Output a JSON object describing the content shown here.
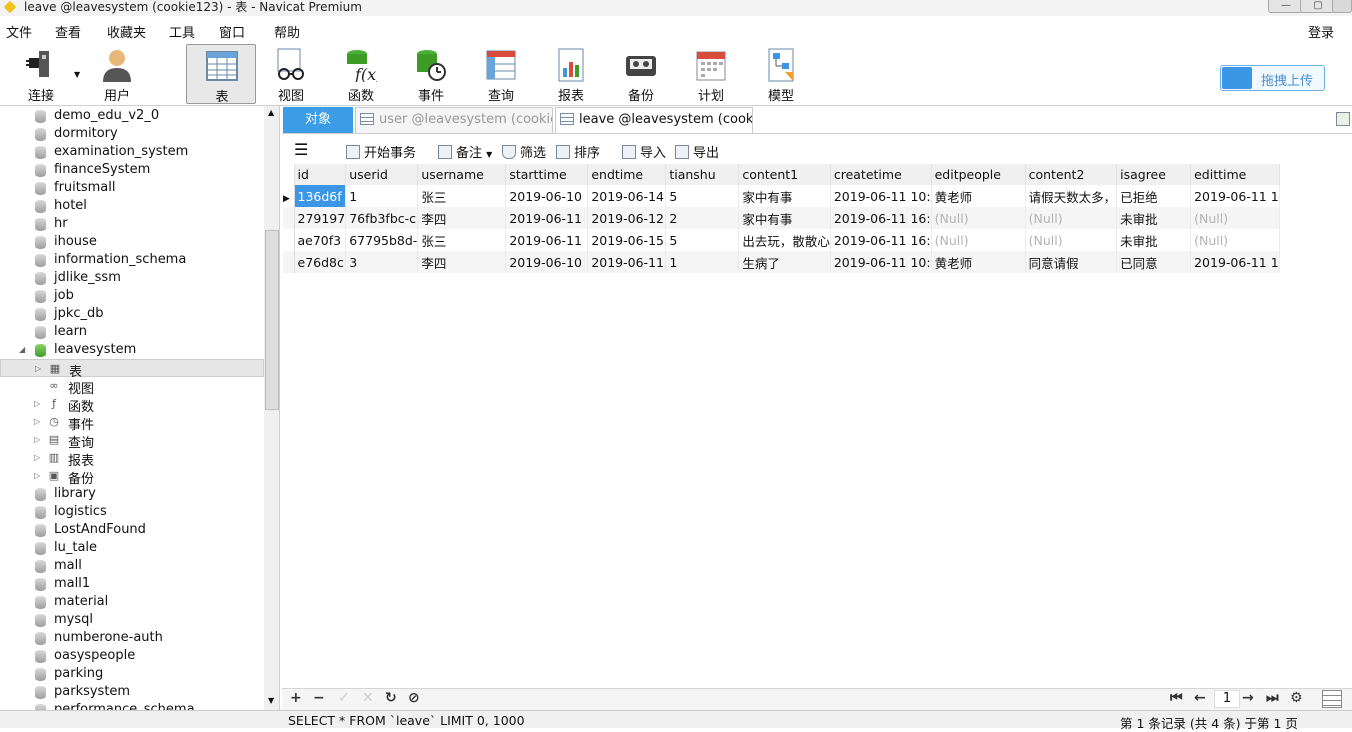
{
  "window": {
    "title": "leave @leavesystem (cookie123) - 表 - Navicat Premium",
    "min": "—",
    "max": "▢",
    "close": "✕"
  },
  "menu": [
    "文件",
    "查看",
    "收藏夹",
    "工具",
    "窗口",
    "帮助"
  ],
  "login": "登录",
  "toolbar": [
    {
      "label": "连接",
      "icon": "plug-icon"
    },
    {
      "label": "用户",
      "icon": "user-icon"
    },
    {
      "label": "表",
      "icon": "table-icon"
    },
    {
      "label": "视图",
      "icon": "glasses-icon"
    },
    {
      "label": "函数",
      "icon": "function-icon"
    },
    {
      "label": "事件",
      "icon": "event-icon"
    },
    {
      "label": "查询",
      "icon": "query-icon"
    },
    {
      "label": "报表",
      "icon": "report-icon"
    },
    {
      "label": "备份",
      "icon": "backup-icon"
    },
    {
      "label": "计划",
      "icon": "calendar-icon"
    },
    {
      "label": "模型",
      "icon": "model-icon"
    }
  ],
  "cloud_button": "拖拽上传",
  "sidebar": {
    "items": [
      "demo_edu_v2_0",
      "dormitory",
      "examination_system",
      "financeSystem",
      "fruitsmall",
      "hotel",
      "hr",
      "ihouse",
      "information_schema",
      "jdlike_ssm",
      "job",
      "jpkc_db",
      "learn",
      "leavesystem"
    ],
    "children": [
      {
        "label": "表",
        "icon": "table-icon"
      },
      {
        "label": "视图",
        "icon": "glasses-icon"
      },
      {
        "label": "函数",
        "icon": "function-icon"
      },
      {
        "label": "事件",
        "icon": "event-icon"
      },
      {
        "label": "查询",
        "icon": "query-icon"
      },
      {
        "label": "报表",
        "icon": "report-icon"
      },
      {
        "label": "备份",
        "icon": "backup-icon"
      }
    ],
    "items_after": [
      "library",
      "logistics",
      "LostAndFound",
      "lu_tale",
      "mall",
      "mall1",
      "material",
      "mysql",
      "numberone-auth",
      "oasyspeople",
      "parking",
      "parksystem",
      "performance_schema"
    ]
  },
  "tabs": {
    "objects": "对象",
    "tab1": "user @leavesystem (cookie...",
    "tab2": "leave @leavesystem (cookie..."
  },
  "subtoolbar": {
    "begin": "开始事务",
    "note": "备注",
    "filter": "筛选",
    "sort": "排序",
    "import": "导入",
    "export": "导出"
  },
  "table": {
    "columns": [
      "id",
      "userid",
      "username",
      "starttime",
      "endtime",
      "tianshu",
      "content1",
      "createtime",
      "editpeople",
      "content2",
      "isagree",
      "edittime"
    ],
    "rows": [
      [
        "136d6f",
        "1",
        "张三",
        "2019-06-10",
        "2019-06-14",
        "5",
        "家中有事",
        "2019-06-11 10:",
        "黄老师",
        "请假天数太多，",
        "已拒绝",
        "2019-06-11 1"
      ],
      [
        "279197",
        "76fb3fbc-c",
        "李四",
        "2019-06-11",
        "2019-06-12",
        "2",
        "家中有事",
        "2019-06-11 16:",
        "(Null)",
        "(Null)",
        "未审批",
        "(Null)"
      ],
      [
        "ae70f3",
        "67795b8d-",
        "张三",
        "2019-06-11",
        "2019-06-15",
        "5",
        "出去玩，散散心",
        "2019-06-11 16:",
        "(Null)",
        "(Null)",
        "未审批",
        "(Null)"
      ],
      [
        "e76d8c",
        "3",
        "李四",
        "2019-06-10",
        "2019-06-11",
        "1",
        "生病了",
        "2019-06-11 10:",
        "黄老师",
        "同意请假",
        "已同意",
        "2019-06-11 1"
      ]
    ]
  },
  "bottom": {
    "page": "1"
  },
  "status": {
    "sql": "SELECT * FROM `leave` LIMIT 0, 1000",
    "records": "第 1 条记录 (共 4 条) 于第 1 页"
  }
}
